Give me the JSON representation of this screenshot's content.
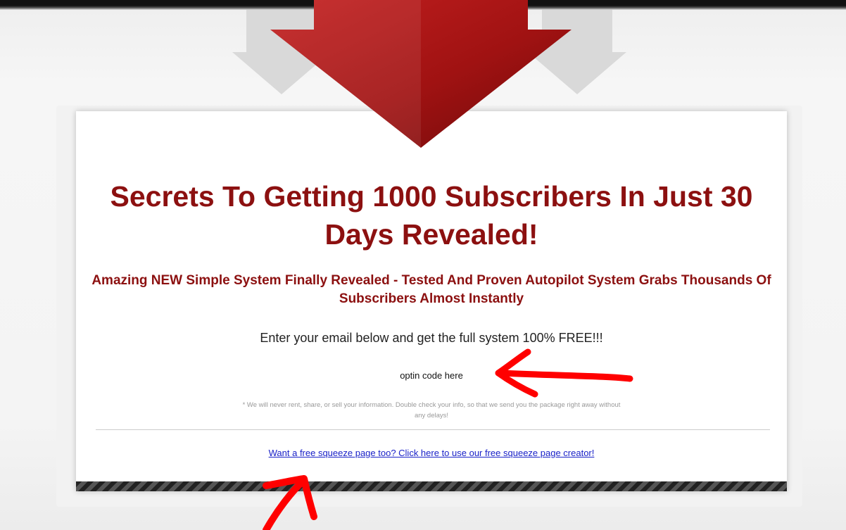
{
  "page": {
    "headline": "Secrets To Getting 1000 Subscribers In Just 30 Days Revealed!",
    "subheadline": "Amazing NEW Simple System Finally Revealed - Tested And Proven Autopilot System Grabs Thousands Of Subscribers Almost Instantly",
    "email_prompt": "Enter your email below and get the full system 100% FREE!!!",
    "optin_placeholder": "optin code here",
    "privacy_note": "* We will never rent, share, or sell your information. Double check your info, so that we send you the package right away without any delays!",
    "squeeze_link": "Want a free squeeze page too? Click here to use our free squeeze page creator!"
  },
  "colors": {
    "headline": "#8c1010",
    "arrow_red": "#a61616",
    "link": "#1a22c8",
    "annotation": "#ff0000"
  },
  "icons": {
    "hero_arrow": "down-arrow-icon",
    "annotations": [
      "hand-drawn-arrow-left",
      "hand-drawn-arrow-up"
    ]
  }
}
